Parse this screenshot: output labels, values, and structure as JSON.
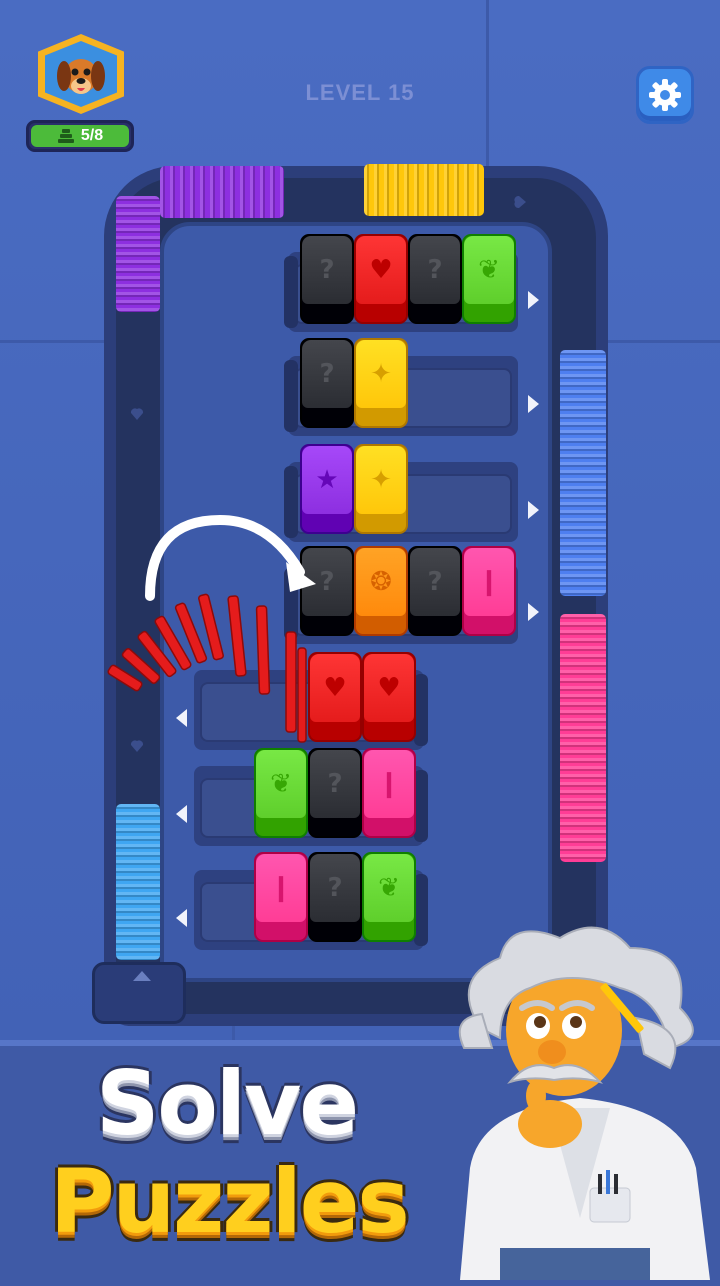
{
  "hud": {
    "level_label": "LEVEL 15",
    "progress_text": "5/8",
    "settings_icon": "gear-icon",
    "avatar_icon": "dog-avatar-icon",
    "progress_icon": "stack-icon"
  },
  "colors": {
    "black": "#2b2d33",
    "red": "#e51c1c",
    "green": "#5fcf2c",
    "yellow": "#ffc70a",
    "purple": "#8d2fe0",
    "orange": "#ff8a0c",
    "pink": "#ff3d96",
    "blue": "#4e7ff0",
    "lightblue": "#3fa6f2"
  },
  "grid": {
    "rows": [
      {
        "direction": "right",
        "blocks": [
          {
            "color": "black",
            "icon": "question-icon"
          },
          {
            "color": "red",
            "icon": "heart-icon"
          },
          {
            "color": "black",
            "icon": "question-icon"
          },
          {
            "color": "green",
            "icon": "leaf-icon"
          }
        ]
      },
      {
        "direction": "right",
        "blocks": [
          {
            "color": "black",
            "icon": "question-icon"
          },
          {
            "color": "yellow",
            "icon": "sparkle-icon"
          }
        ]
      },
      {
        "direction": "right",
        "blocks": [
          {
            "color": "purple",
            "icon": "star-icon"
          },
          {
            "color": "yellow",
            "icon": "sparkle-icon"
          }
        ]
      },
      {
        "direction": "right",
        "blocks": [
          {
            "color": "black",
            "icon": "question-icon"
          },
          {
            "color": "orange",
            "icon": "paw-icon"
          },
          {
            "color": "black",
            "icon": "question-icon"
          },
          {
            "color": "pink",
            "icon": "bar-icon"
          }
        ]
      },
      {
        "direction": "left",
        "blocks": [
          {
            "color": "red",
            "icon": "heart-icon"
          },
          {
            "color": "red",
            "icon": "heart-icon"
          }
        ]
      },
      {
        "direction": "left",
        "blocks": [
          {
            "color": "green",
            "icon": "leaf-icon"
          },
          {
            "color": "black",
            "icon": "question-icon"
          },
          {
            "color": "pink",
            "icon": "bar-icon"
          }
        ]
      },
      {
        "direction": "left",
        "blocks": [
          {
            "color": "pink",
            "icon": "bar-icon"
          },
          {
            "color": "black",
            "icon": "question-icon"
          },
          {
            "color": "green",
            "icon": "leaf-icon"
          }
        ]
      }
    ]
  },
  "track_stacks": [
    {
      "name": "purple-stack",
      "color": "purple"
    },
    {
      "name": "yellow-stack",
      "color": "yellow"
    },
    {
      "name": "blue-stack",
      "color": "blue"
    },
    {
      "name": "pink-stack",
      "color": "pink"
    },
    {
      "name": "lightblue-stack",
      "color": "lightblue"
    }
  ],
  "promo": {
    "line1": "Solve",
    "line2": "Puzzles"
  }
}
